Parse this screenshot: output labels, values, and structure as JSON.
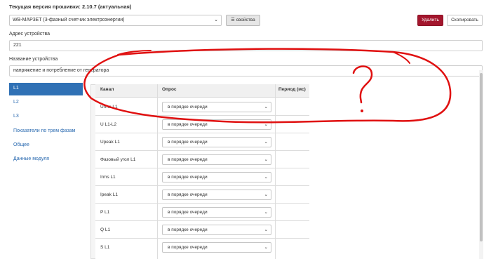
{
  "firmware_title": "Текущая версия прошивки: 2.10.7 (актуальная)",
  "device_select": {
    "value": "WB-MAP3ET (3-фазный счетчик электроэнергии)"
  },
  "buttons": {
    "properties": "свойства",
    "delete": "Удалить",
    "copy": "Скопировать"
  },
  "address": {
    "label": "Адрес устройства",
    "value": "221"
  },
  "name": {
    "label": "Название устройства",
    "value": "напряжение и потребление от генератора"
  },
  "sidebar": {
    "items": [
      {
        "label": "L1"
      },
      {
        "label": "L2"
      },
      {
        "label": "L3"
      },
      {
        "label": "Показатели по трем фазам"
      },
      {
        "label": "Общее"
      },
      {
        "label": "Данные модуля"
      }
    ]
  },
  "table": {
    "headers": {
      "channel": "Канал",
      "poll": "Опрос",
      "period": "Период (мс)"
    },
    "rows": [
      {
        "channel": "Urms L1",
        "poll": "в порядке очереди"
      },
      {
        "channel": "U L1-L2",
        "poll": "в порядке очереди"
      },
      {
        "channel": "Upeak L1",
        "poll": "в порядке очереди"
      },
      {
        "channel": "Фазовый угол L1",
        "poll": "в порядке очереди"
      },
      {
        "channel": "Irms L1",
        "poll": "в порядке очереди"
      },
      {
        "channel": "Ipeak L1",
        "poll": "в порядке очереди"
      },
      {
        "channel": "P L1",
        "poll": "в порядке очереди"
      },
      {
        "channel": "Q L1",
        "poll": "в порядке очереди"
      },
      {
        "channel": "S L1",
        "poll": "в порядке очереди"
      }
    ]
  },
  "annotation": {
    "mark": "?",
    "color": "#e01010"
  },
  "colors": {
    "accent_blue": "#3071b5",
    "delete_red": "#a3162d",
    "link_blue": "#2a6ab0"
  }
}
